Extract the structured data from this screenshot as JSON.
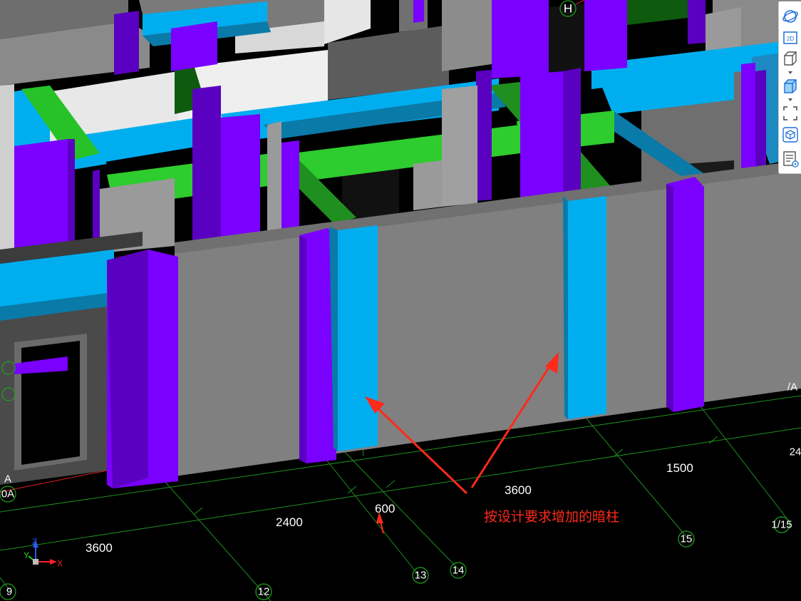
{
  "axes": {
    "grid_h": "H",
    "grid_9": "9",
    "grid_10a": "0A",
    "grid_12": "12",
    "grid_13": "13",
    "grid_14": "14",
    "grid_15": "15",
    "grid_1_15": "1/15",
    "edge_a": "A",
    "edge_right": "24",
    "edge_right_a": "/A"
  },
  "dimensions": {
    "d_3600_left": "3600",
    "d_2400": "2400",
    "d_600": "600",
    "d_3600_right": "3600",
    "d_1500": "1500"
  },
  "annotation": {
    "text": "按设计要求增加的暗柱",
    "color": "#ff2a1a"
  },
  "ucs": {
    "x": "X",
    "y": "Y",
    "z": "Z"
  },
  "toolbar": {
    "items": [
      {
        "icon": "orbit-icon"
      },
      {
        "icon": "2d-view-icon",
        "label": "2D"
      },
      {
        "icon": "3d-box-icon"
      },
      {
        "icon": "dropdown-caret-icon"
      },
      {
        "icon": "shaded-box-icon"
      },
      {
        "icon": "dropdown-caret-icon"
      },
      {
        "icon": "fullscreen-icon"
      },
      {
        "icon": "component-cube-icon"
      },
      {
        "icon": "property-list-icon"
      }
    ]
  },
  "colors": {
    "background": "#000000",
    "wall": "#808080",
    "column": "#7a00ff",
    "concealed_column": "#00aeef",
    "beam_green": "#2ecc2e",
    "grid_line": "#1f8f1f",
    "annotation": "#ff2a1a"
  }
}
